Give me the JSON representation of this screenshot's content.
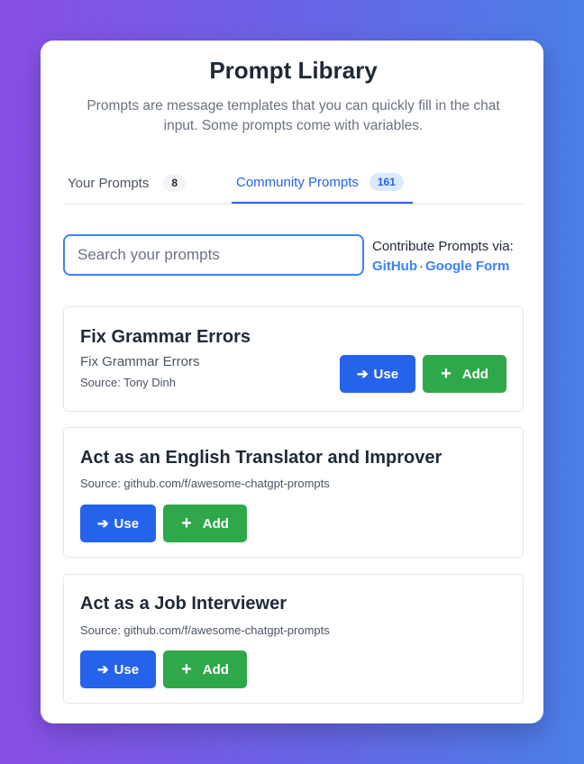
{
  "header": {
    "title": "Prompt Library",
    "subtitle": "Prompts are message templates that you can quickly fill in the chat input. Some prompts come with variables."
  },
  "tabs": [
    {
      "label": "Your Prompts",
      "count": "8"
    },
    {
      "label": "Community Prompts",
      "count": "161"
    }
  ],
  "search": {
    "placeholder": "Search your prompts"
  },
  "contribute": {
    "label": "Contribute Prompts via:",
    "github": "GitHub",
    "separator": "·",
    "google_form": "Google Form"
  },
  "prompts": [
    {
      "title": "Fix Grammar Errors",
      "description": "Fix Grammar Errors",
      "source": "Source: Tony Dinh"
    },
    {
      "title": "Act as an English Translator and Improver",
      "source": "Source: github.com/f/awesome-chatgpt-prompts"
    },
    {
      "title": "Act as a Job Interviewer",
      "source": "Source: github.com/f/awesome-chatgpt-prompts"
    }
  ],
  "buttons": {
    "use_icon": "➔",
    "use_label": "Use",
    "add_icon": "+",
    "add_label": "Add"
  },
  "colors": {
    "accent": "#2563eb",
    "add": "#2ea84a"
  }
}
